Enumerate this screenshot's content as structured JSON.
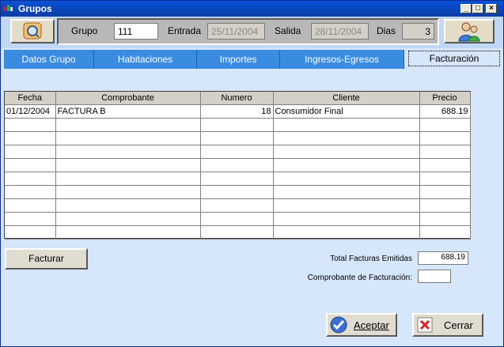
{
  "window": {
    "title": "Grupos",
    "buttons": [
      "_",
      "□",
      "×"
    ]
  },
  "filters": {
    "grupo_label": "Grupo",
    "grupo_value": "111",
    "entrada_label": "Entrada",
    "entrada_value": "25/11/2004",
    "salida_label": "Salida",
    "salida_value": "28/11/2004",
    "dias_label": "Dias",
    "dias_value": "3"
  },
  "tabs": [
    {
      "label": "Datos Grupo"
    },
    {
      "label": "Habitaciones"
    },
    {
      "label": "Importes"
    },
    {
      "label": "Ingresos-Egresos"
    },
    {
      "label": "Facturación"
    }
  ],
  "grid": {
    "columns": [
      "Fecha",
      "Comprobante",
      "Numero",
      "Cliente",
      "Precio"
    ],
    "rows": [
      [
        "01/12/2004",
        "FACTURA B",
        "18",
        "Consumidor Final",
        "688.19"
      ]
    ]
  },
  "actions": {
    "facturar_label": "Facturar",
    "total_label": "Total Facturas Emitidas",
    "total_value": "688.19",
    "comprobante_label": "Comprobante de Facturación:",
    "comprobante_value": "",
    "aceptar_label": "Aceptar",
    "cerrar_label": "Cerrar"
  },
  "icons": {
    "search": "search-icon",
    "users": "users-icon",
    "accept": "check-icon",
    "close": "close-icon"
  }
}
